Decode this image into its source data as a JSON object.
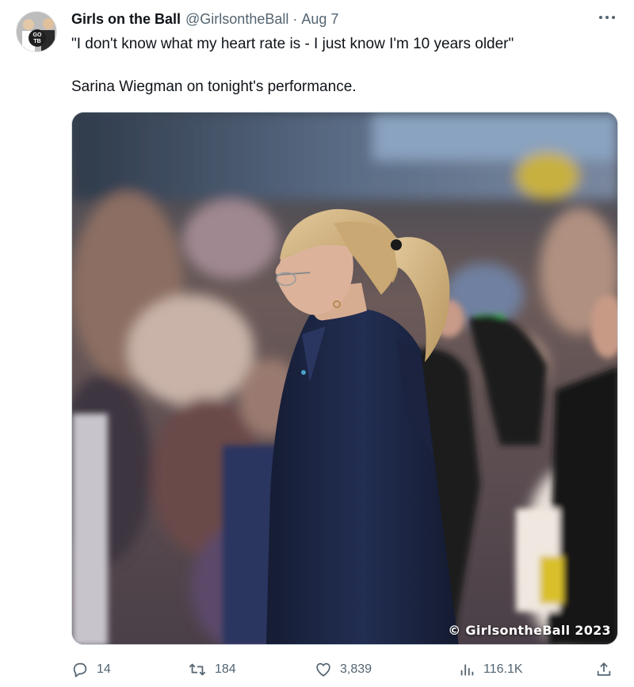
{
  "tweet": {
    "display_name": "Girls on the Ball",
    "handle": "@GirlsontheBall",
    "separator": "·",
    "date": "Aug 7",
    "more_icon": "more-horizontal-icon",
    "avatar_text": "GO TB",
    "text_line1": "\"I don't know what my heart rate is - I just know I'm 10 years older\"",
    "text_line2": "Sarina Wiegman on tonight's performance."
  },
  "media": {
    "watermark": "© GirlsontheBall 2023"
  },
  "actions": {
    "reply_count": "14",
    "retweet_count": "184",
    "like_count": "3,839",
    "view_count": "116.1K",
    "icons": [
      "reply-icon",
      "retweet-icon",
      "like-icon",
      "views-icon",
      "share-icon"
    ]
  },
  "colors": {
    "text": "#0f1419",
    "secondary": "#536471",
    "coat": "#1e2a4a",
    "hair": "#d6b98a"
  }
}
